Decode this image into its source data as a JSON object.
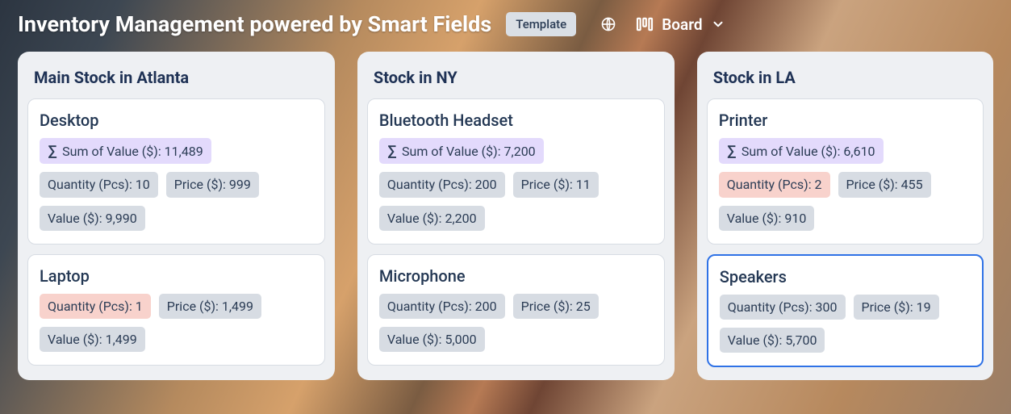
{
  "header": {
    "title": "Inventory Management powered by Smart Fields",
    "template_badge": "Template",
    "view_label": "Board"
  },
  "labels": {
    "sum_prefix": "Sum of Value ($): ",
    "qty_prefix": "Quantity (Pcs): ",
    "price_prefix": "Price ($): ",
    "value_prefix": "Value ($): "
  },
  "columns": [
    {
      "title": "Main Stock in Atlanta",
      "cards": [
        {
          "title": "Desktop",
          "sum": "11,489",
          "qty": "10",
          "qty_warn": false,
          "price": "999",
          "value": "9,990",
          "selected": false
        },
        {
          "title": "Laptop",
          "sum": null,
          "qty": "1",
          "qty_warn": true,
          "price": "1,499",
          "value": "1,499",
          "selected": false
        }
      ]
    },
    {
      "title": "Stock in NY",
      "cards": [
        {
          "title": "Bluetooth Headset",
          "sum": "7,200",
          "qty": "200",
          "qty_warn": false,
          "price": "11",
          "value": "2,200",
          "selected": false
        },
        {
          "title": "Microphone",
          "sum": null,
          "qty": "200",
          "qty_warn": false,
          "price": "25",
          "value": "5,000",
          "selected": false
        }
      ]
    },
    {
      "title": "Stock in LA",
      "cards": [
        {
          "title": "Printer",
          "sum": "6,610",
          "qty": "2",
          "qty_warn": true,
          "price": "455",
          "value": "910",
          "selected": false
        },
        {
          "title": "Speakers",
          "sum": null,
          "qty": "300",
          "qty_warn": false,
          "price": "19",
          "value": "5,700",
          "selected": true
        }
      ]
    }
  ]
}
